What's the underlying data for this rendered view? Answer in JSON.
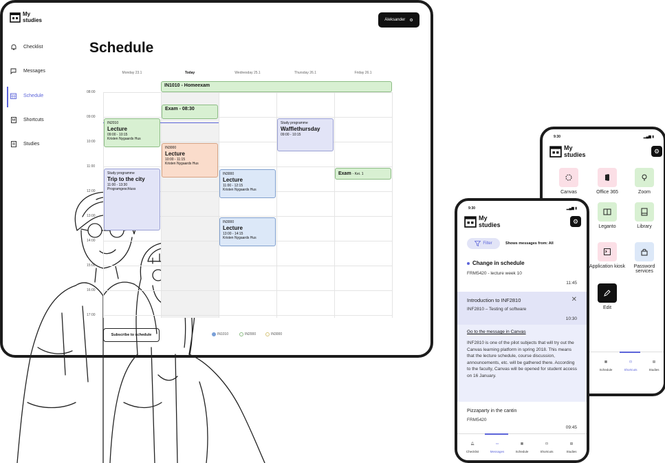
{
  "brand": {
    "line1": "My",
    "line2": "studies"
  },
  "desktop": {
    "user": "Aleksander",
    "sidebar": [
      {
        "label": "Checklist",
        "icon": "bell-icon"
      },
      {
        "label": "Messages",
        "icon": "message-icon"
      },
      {
        "label": "Schedule",
        "icon": "calendar-icon",
        "active": true
      },
      {
        "label": "Shortcuts",
        "icon": "bookmark-icon"
      },
      {
        "label": "Studies",
        "icon": "book-icon"
      }
    ],
    "title": "Schedule",
    "days": [
      "Monday 23.1",
      "Today",
      "Wednesday 25.1",
      "Thursday 26.1",
      "Friday 26.1"
    ],
    "times": [
      "08:00",
      "09:00",
      "10:00",
      "11:00",
      "12:00",
      "13:00",
      "14:00",
      "15:00",
      "16:00",
      "17:00"
    ],
    "events": {
      "homeexam": {
        "title": "IN1010 - Homeexam"
      },
      "exam1": {
        "title": "Exam - 08:30"
      },
      "lec_mon": {
        "code": "IN2010",
        "title": "Lecture",
        "time": "09:00 - 10:15",
        "place": "Kristen Nygaards Hus"
      },
      "lec_tue": {
        "code": "IN3000",
        "title": "Lecture",
        "time": "10:00 - 11:15",
        "place": "Kristen Nygaards Hus"
      },
      "waffle": {
        "code": "Study programme",
        "title": "Wafflethursday",
        "time": "09:00 - 10:15"
      },
      "exam2": {
        "title": "Exam",
        "suffix": "- Kei. 1"
      },
      "trip": {
        "code": "Study programme",
        "title": "Trip to the city",
        "time": "11:00 - 13:30",
        "place": "Programgeschluss"
      },
      "lec_wed1": {
        "code": "IN3000",
        "title": "Lecture",
        "time": "11:00 - 12:15",
        "place": "Kristen Nygaards Hus"
      },
      "lec_wed2": {
        "code": "IN3000",
        "title": "Lecture",
        "time": "13:00 - 14:15",
        "place": "Kristen Nygaards Hus"
      }
    },
    "subscribe": "Subscribe to schedule",
    "legend": [
      "IN1010",
      "IN2000",
      "IN3000"
    ],
    "colors": {
      "accent": "#5b63d9",
      "green": "#d8f0d2",
      "blue": "#dce8f8",
      "lavender": "#e2e4f7",
      "orange": "#fadccb"
    }
  },
  "phone_shortcuts": {
    "time": "9:30",
    "apps": [
      {
        "label": "Canvas",
        "icon": "canvas-icon",
        "color": "#fbdfe6"
      },
      {
        "label": "Office 365",
        "icon": "office-icon",
        "color": "#fbdfe6"
      },
      {
        "label": "Zoom",
        "icon": "zoom-icon",
        "color": "#d8f0d2"
      },
      {
        "label": "Leganto",
        "icon": "leganto-icon",
        "color": "#d8f0d2"
      },
      {
        "label": "Library",
        "icon": "library-icon",
        "color": "#d8f0d2"
      },
      {
        "label": "Application kiosk",
        "icon": "kiosk-icon",
        "color": "#fbdfe6"
      },
      {
        "label": "Password services",
        "icon": "lock-icon",
        "color": "#dce8f8"
      },
      {
        "label": "Edit",
        "icon": "pencil-icon",
        "color": "#111111"
      }
    ],
    "tabs": [
      "Schedule",
      "Shortcuts",
      "Studies"
    ]
  },
  "phone_messages": {
    "time": "9:30",
    "filter": "Filter",
    "shows_from": "Shows messages from:",
    "shows_from_value": "All",
    "messages": [
      {
        "title": "Change in schedule",
        "sub": "FRM5420 - lecture week 10",
        "time": "11:45",
        "unread": true
      },
      {
        "title": "Introduction to INF2810",
        "sub": "INF2810 – Testing of software",
        "time": "10:30",
        "link": "Go to the message in Canvas",
        "body": "INF2810 is one of the pilot subjects that will try out the Canvas learning platform in spring 2018. This means that the lecture schedule, course discussion, announcements, etc. will be gathered there. According to the faculty, Canvas will be opened for student access on 16 January."
      },
      {
        "title": "Pizzaparty in the cantin",
        "sub": "FRM5420",
        "time": "09:45"
      }
    ],
    "tabs": [
      "Checklist",
      "Messages",
      "Schedule",
      "Shortcuts",
      "Studies"
    ]
  }
}
